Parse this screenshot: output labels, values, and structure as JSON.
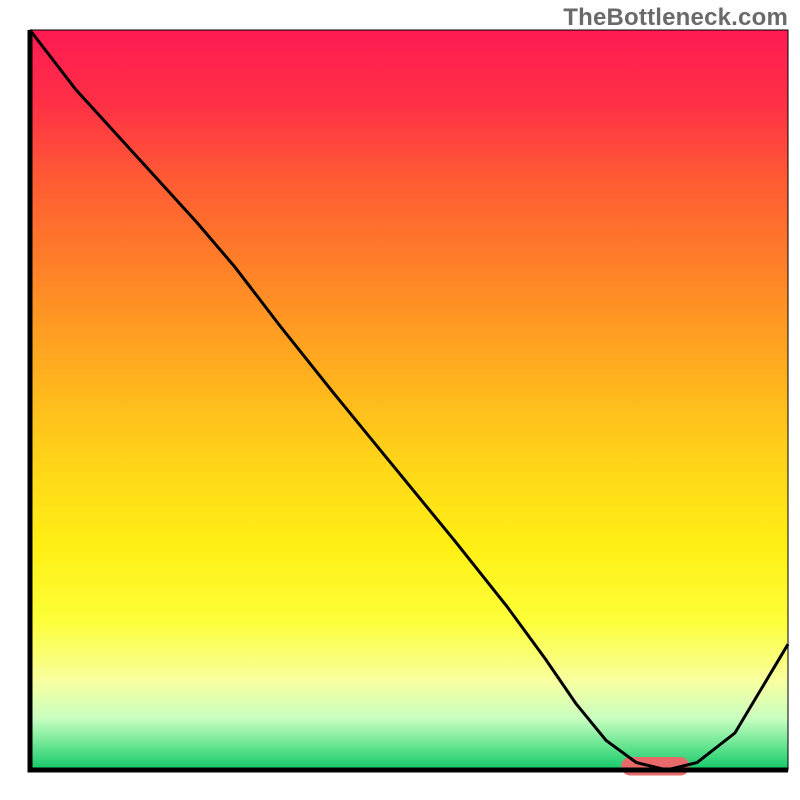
{
  "watermark": "TheBottleneck.com",
  "chart_data": {
    "type": "line",
    "title": "",
    "xlabel": "",
    "ylabel": "",
    "xlim": [
      0,
      100
    ],
    "ylim": [
      0,
      100
    ],
    "grid": false,
    "legend": false,
    "background": {
      "type": "vertical-gradient",
      "stops": [
        {
          "offset": 0.0,
          "color": "#ff1a52"
        },
        {
          "offset": 0.1,
          "color": "#ff3046"
        },
        {
          "offset": 0.2,
          "color": "#ff5a34"
        },
        {
          "offset": 0.3,
          "color": "#ff7a2a"
        },
        {
          "offset": 0.4,
          "color": "#ff9a22"
        },
        {
          "offset": 0.5,
          "color": "#ffbb1c"
        },
        {
          "offset": 0.6,
          "color": "#ffd918"
        },
        {
          "offset": 0.7,
          "color": "#fff014"
        },
        {
          "offset": 0.8,
          "color": "#fdff3a"
        },
        {
          "offset": 0.88,
          "color": "#f8ffa0"
        },
        {
          "offset": 0.93,
          "color": "#c9ffc0"
        },
        {
          "offset": 0.97,
          "color": "#5fe28e"
        },
        {
          "offset": 1.0,
          "color": "#12c86a"
        }
      ]
    },
    "series": [
      {
        "name": "bottleneck-curve",
        "color": "#000000",
        "stroke_width": 3,
        "x": [
          0,
          6,
          14,
          22,
          27,
          33,
          40,
          48,
          56,
          63,
          68,
          72,
          76,
          80,
          84,
          88,
          93,
          100
        ],
        "y": [
          100,
          92,
          83,
          74,
          68,
          60,
          51,
          41,
          31,
          22,
          15,
          9,
          4,
          1,
          0,
          1,
          5,
          17
        ]
      }
    ],
    "marker": {
      "name": "optimal-range",
      "shape": "rounded-bar",
      "color": "#e86a6a",
      "x_start": 78,
      "x_end": 87,
      "y": 0.5,
      "thickness": 2.5
    },
    "axes": {
      "show_ticks": false,
      "show_labels": false,
      "frame": true,
      "frame_color": "#000000",
      "frame_width": 3
    }
  }
}
